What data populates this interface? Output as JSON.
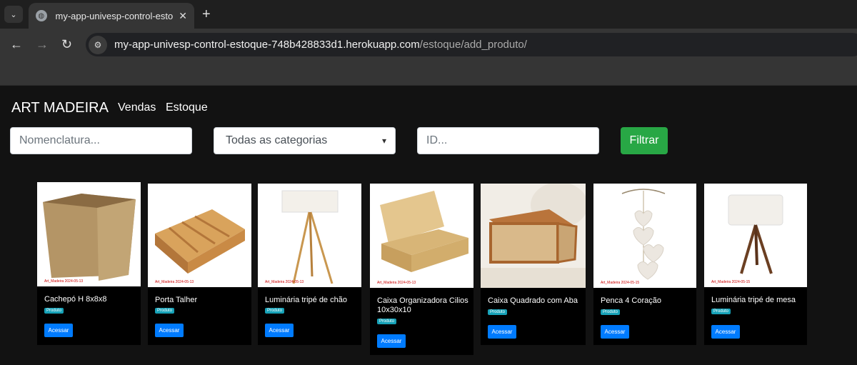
{
  "browser": {
    "tab_title": "my-app-univesp-control-estoque",
    "tab_close": "✕",
    "new_tab": "+",
    "url_host": "my-app-univesp-control-estoque-748b428833d1.herokuapp.com",
    "url_path": "/estoque/add_produto/"
  },
  "navbar": {
    "brand": "ART MADEIRA",
    "links": [
      "Vendas",
      "Estoque"
    ]
  },
  "filters": {
    "nome_placeholder": "Nomenclatura...",
    "categoria_selected": "Todas as categorias",
    "id_placeholder": "ID...",
    "filter_button": "Filtrar"
  },
  "products": [
    {
      "name": "Cachepó H 8x8x8",
      "badge": "Produto",
      "button": "Acessar",
      "watermark": "Art_Madeira 2024-05-13"
    },
    {
      "name": "Porta Talher",
      "badge": "Produto",
      "button": "Acessar",
      "watermark": "Art_Madeira 2024-05-13"
    },
    {
      "name": "Luminária tripé de chão",
      "badge": "Produto",
      "button": "Acessar",
      "watermark": "Art_Madeira 2024-05-13"
    },
    {
      "name": "Caixa Organizadora Cilios 10x30x10",
      "badge": "Produto",
      "button": "Acessar",
      "watermark": "Art_Madeira 2024-05-13"
    },
    {
      "name": "Caixa Quadrado com Aba",
      "badge": "Produto",
      "button": "Acessar",
      "watermark": ""
    },
    {
      "name": "Penca 4 Coração",
      "badge": "Produto",
      "button": "Acessar",
      "watermark": "Art_Madeira 2024-05-15"
    },
    {
      "name": "Luminária tripé de mesa",
      "badge": "Produto",
      "button": "Acessar",
      "watermark": "Art_Madeira 2024-05-15"
    }
  ],
  "colors": {
    "accent_green": "#28a745",
    "accent_blue": "#007bff",
    "badge_cyan": "#17a2b8"
  }
}
